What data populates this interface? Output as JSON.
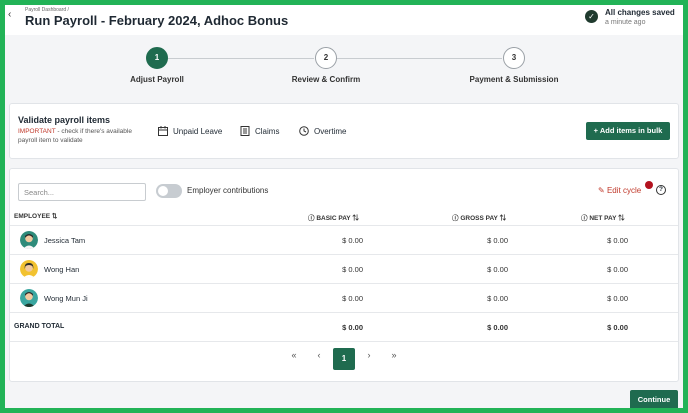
{
  "header": {
    "breadcrumb": "Payroll Dashboard /",
    "title": "Run Payroll - February 2024, Adhoc Bonus",
    "save_status": "All changes saved",
    "save_time": "a minute ago"
  },
  "stepper": {
    "steps": [
      {
        "number": "1",
        "label": "Adjust Payroll",
        "state": "active"
      },
      {
        "number": "2",
        "label": "Review & Confirm",
        "state": "inactive"
      },
      {
        "number": "3",
        "label": "Payment & Submission",
        "state": "inactive"
      }
    ]
  },
  "validate": {
    "title": "Validate payroll items",
    "important_label": "IMPORTANT",
    "note": " - check if there's available payroll item to validate",
    "filters": [
      {
        "label": "Unpaid Leave",
        "icon": "calendar-icon"
      },
      {
        "label": "Claims",
        "icon": "document-icon"
      },
      {
        "label": "Overtime",
        "icon": "clock-icon"
      }
    ],
    "add_bulk_label": "+ Add items in bulk"
  },
  "table": {
    "search_placeholder": "Search...",
    "employer_contributions_label": "Employer contributions",
    "employer_contributions_on": false,
    "edit_cycle_label": "Edit cycle",
    "columns": {
      "employee": "EMPLOYEE ⇅",
      "basic_pay": "BASIC PAY ⇅",
      "gross_pay": "GROSS PAY ⇅",
      "net_pay": "NET PAY ⇅"
    },
    "rows": [
      {
        "name": "Jessica Tam",
        "basic_pay": "$ 0.00",
        "gross_pay": "$ 0.00",
        "net_pay": "$ 0.00"
      },
      {
        "name": "Wong Han",
        "basic_pay": "$ 0.00",
        "gross_pay": "$ 0.00",
        "net_pay": "$ 0.00"
      },
      {
        "name": "Wong Mun Ji",
        "basic_pay": "$ 0.00",
        "gross_pay": "$ 0.00",
        "net_pay": "$ 0.00"
      }
    ],
    "grand_total": {
      "label": "GRAND TOTAL",
      "basic_pay": "$ 0.00",
      "gross_pay": "$ 0.00",
      "net_pay": "$ 0.00"
    }
  },
  "pagination": {
    "first": "«",
    "prev": "‹",
    "current": "1",
    "next": "›",
    "last": "»"
  },
  "footer": {
    "continue_label": "Continue"
  },
  "colors": {
    "primary": "#1f6b4f",
    "frame": "#22b357",
    "important": "#c0392b"
  }
}
